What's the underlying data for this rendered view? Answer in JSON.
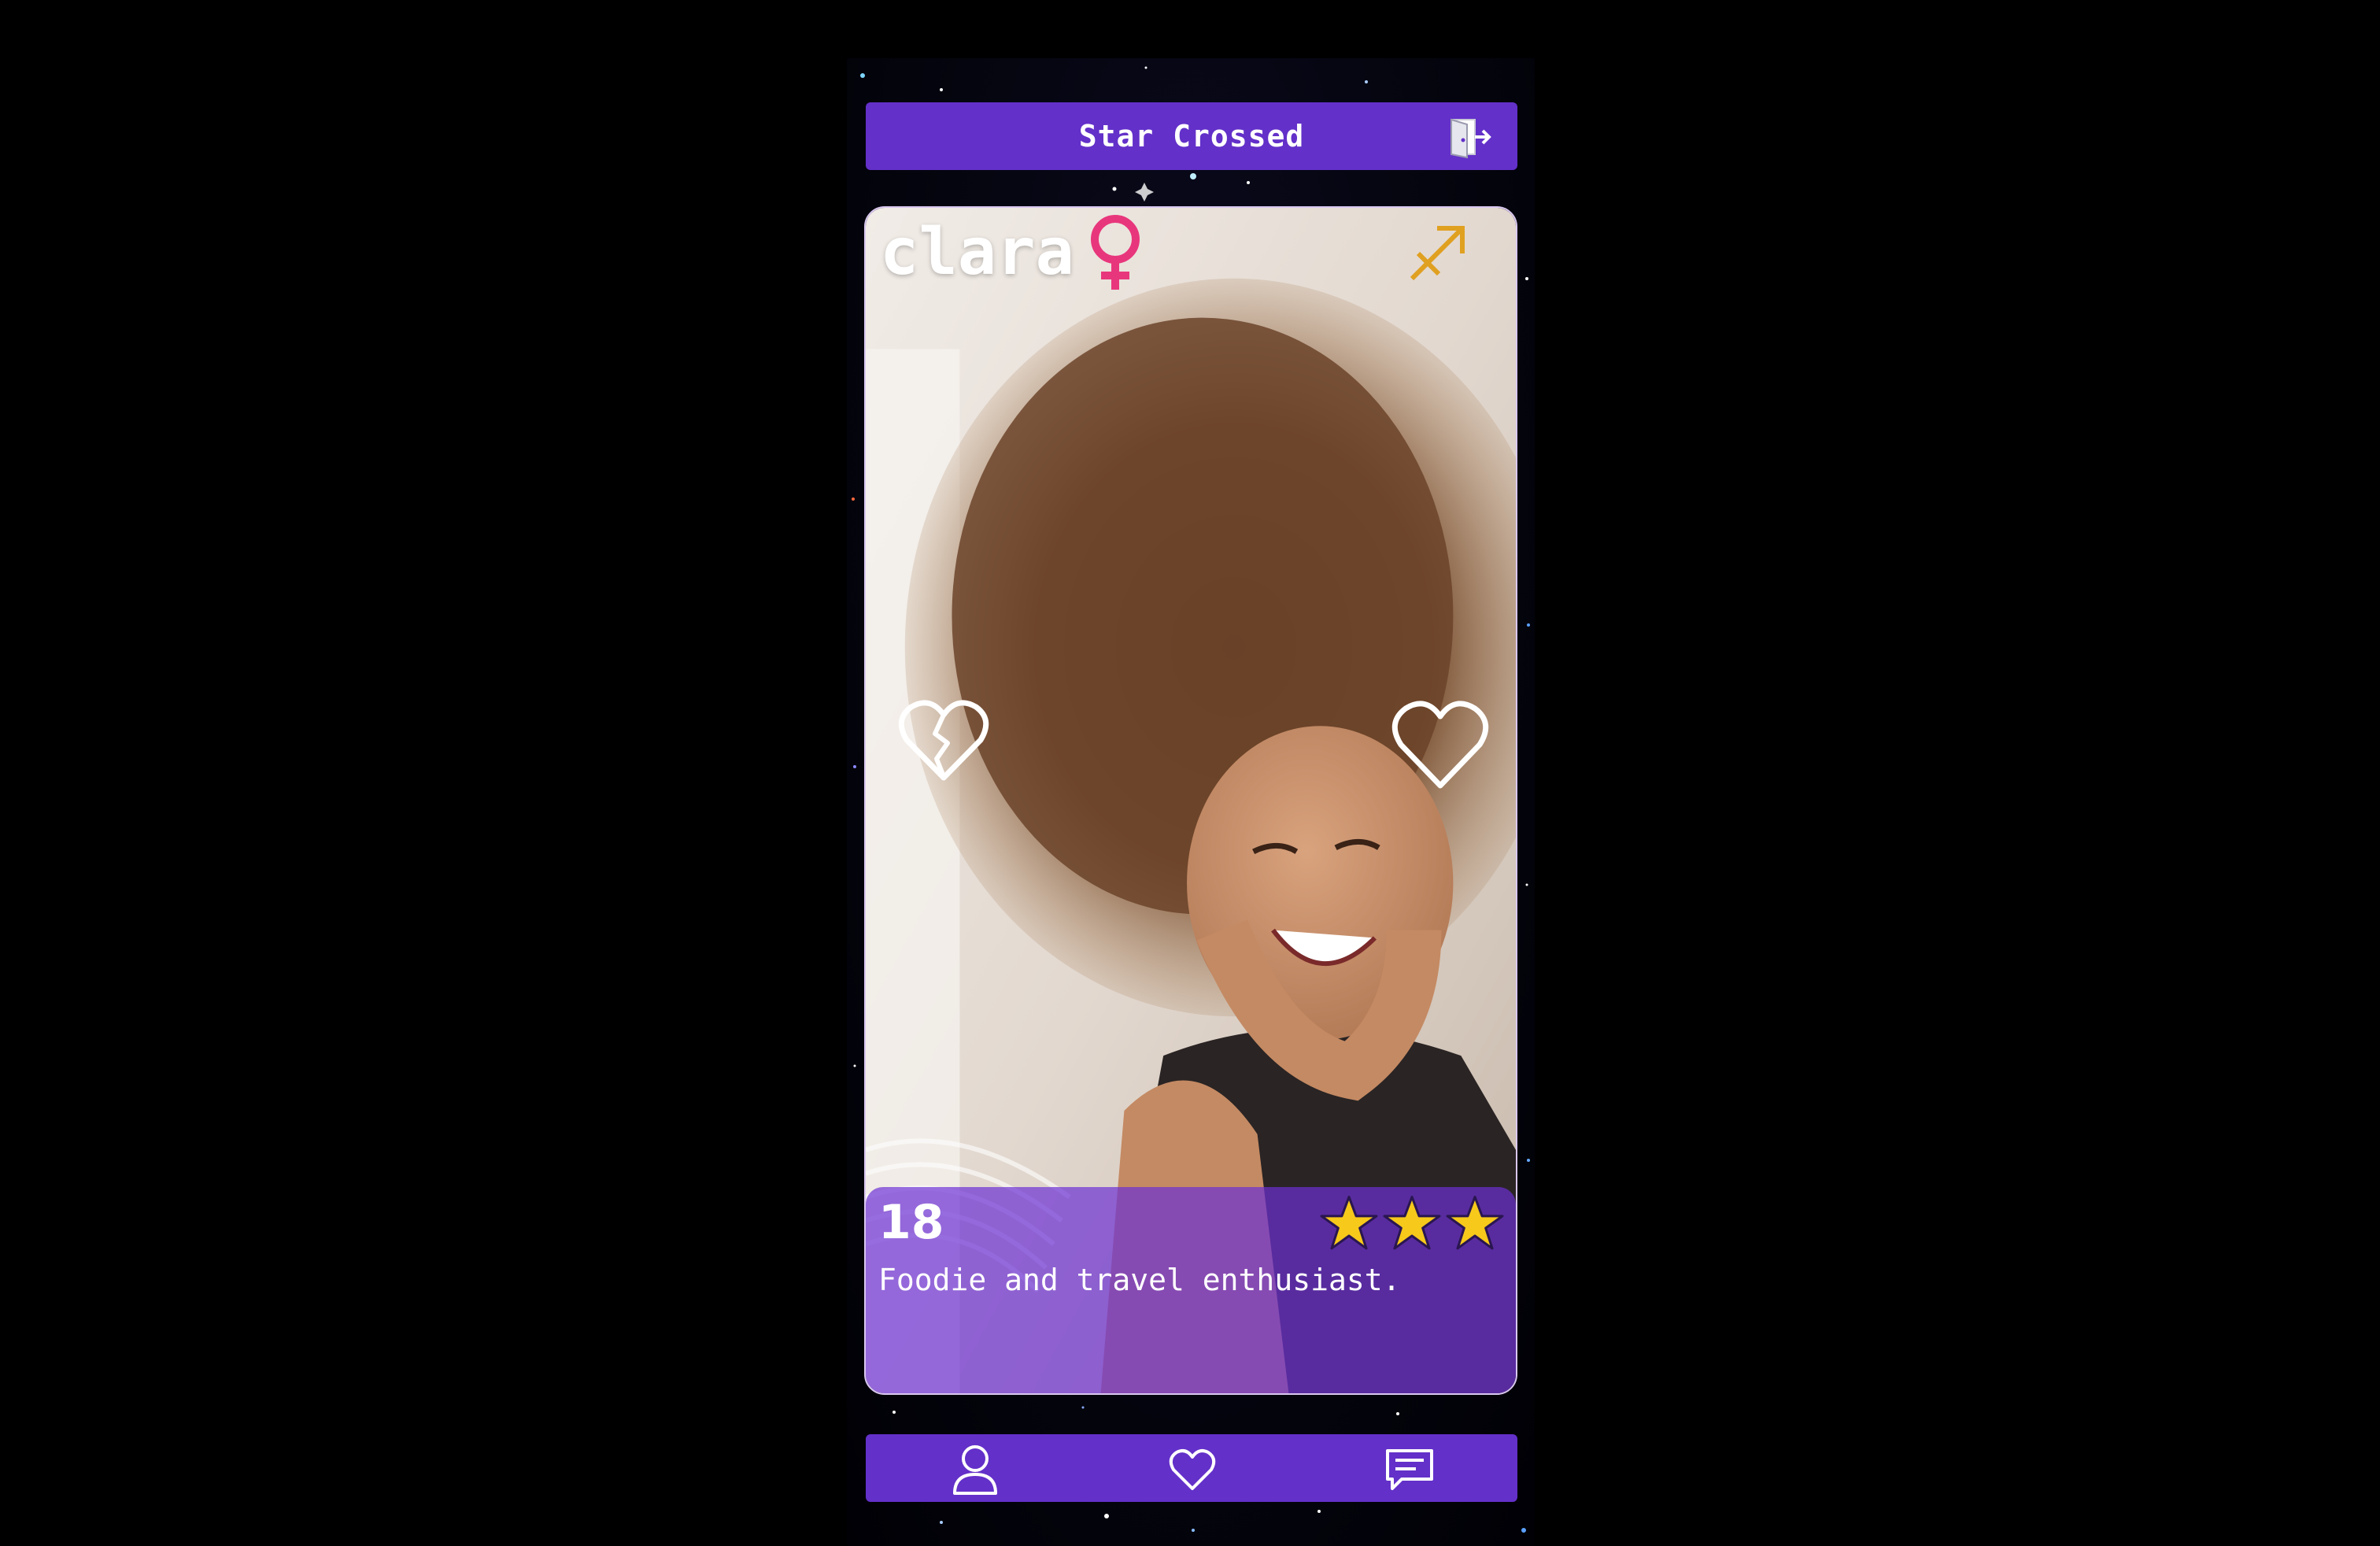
{
  "app": {
    "title": "Star Crossed"
  },
  "profile": {
    "name": "clara",
    "gender": "female",
    "zodiac": "sagittarius",
    "age": "18",
    "bio": "Foodie and travel enthusiast.",
    "rating": 3,
    "rating_max": 3
  },
  "icons": {
    "logout": "logout-door-icon",
    "gender": "female-symbol-icon",
    "zodiac": "sagittarius-icon",
    "dislike": "broken-heart-icon",
    "like": "heart-icon",
    "star": "star-icon",
    "nav_profile": "person-icon",
    "nav_likes": "heart-icon",
    "nav_chat": "chat-bubble-icon"
  },
  "colors": {
    "accent": "#6330c9",
    "gender": "#e8367c",
    "zodiac": "#e0a020",
    "star": "#f7c91a",
    "panel": "#6c30d4"
  }
}
